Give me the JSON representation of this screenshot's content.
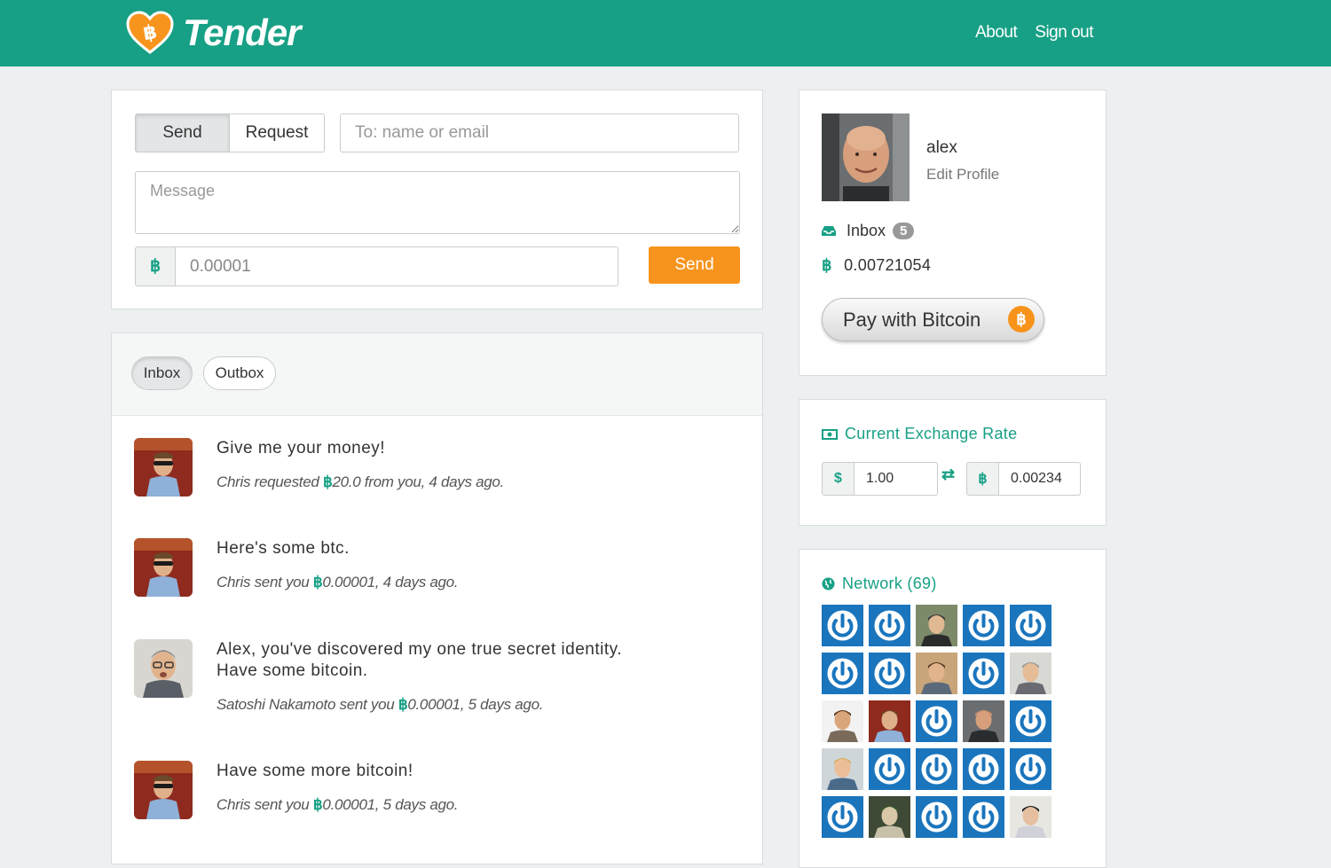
{
  "brand": {
    "name": "Tender",
    "logo_symbol": "฿"
  },
  "nav": {
    "about": "About",
    "sign_out": "Sign out"
  },
  "compose": {
    "send_tab": "Send",
    "request_tab": "Request",
    "to_placeholder": "To: name or email",
    "message_placeholder": "Message",
    "currency_symbol": "฿",
    "amount_value": "0.00001",
    "send_button": "Send"
  },
  "feed": {
    "tabs": {
      "inbox": "Inbox",
      "outbox": "Outbox"
    },
    "btc_symbol": "฿",
    "items": [
      {
        "title": "Give me your money!",
        "prefix": "Chris requested ",
        "amount": "20.0",
        "suffix": " from you, 4 days ago.",
        "avatar": "chris"
      },
      {
        "title": "Here's some btc.",
        "prefix": "Chris sent you ",
        "amount": "0.00001",
        "suffix": ", 4 days ago.",
        "avatar": "chris"
      },
      {
        "title": "Alex, you've discovered my one true secret identity.\nHave some bitcoin.",
        "prefix": "Satoshi Nakamoto sent you ",
        "amount": "0.00001",
        "suffix": ", 5 days ago.",
        "avatar": "satoshi"
      },
      {
        "title": "Have some more bitcoin!",
        "prefix": "Chris sent you ",
        "amount": "0.00001",
        "suffix": ", 5 days ago.",
        "avatar": "chris"
      }
    ]
  },
  "profile": {
    "name": "alex",
    "edit_link": "Edit Profile",
    "inbox_label": "Inbox",
    "inbox_count": "5",
    "btc_symbol": "฿",
    "balance": "0.00721054",
    "pay_button": "Pay with Bitcoin",
    "pay_coin_symbol": "฿"
  },
  "exchange": {
    "title": "Current Exchange Rate",
    "usd_symbol": "$",
    "usd_value": "1.00",
    "btc_symbol": "฿",
    "btc_value": "0.00234"
  },
  "network": {
    "title": "Network (69)",
    "members": [
      "power",
      "power",
      "photo-suit",
      "power",
      "power",
      "power",
      "power",
      "photo-smile",
      "power",
      "photo-glasses",
      "photo-beard",
      "photo-chris",
      "power",
      "photo-bald",
      "power",
      "photo-blond",
      "power",
      "power",
      "power",
      "power",
      "power",
      "photo-hat",
      "power",
      "power",
      "photo-asian"
    ]
  },
  "colors": {
    "brand": "#17a085",
    "accent": "#f7941d",
    "tile": "#1a75bd"
  }
}
